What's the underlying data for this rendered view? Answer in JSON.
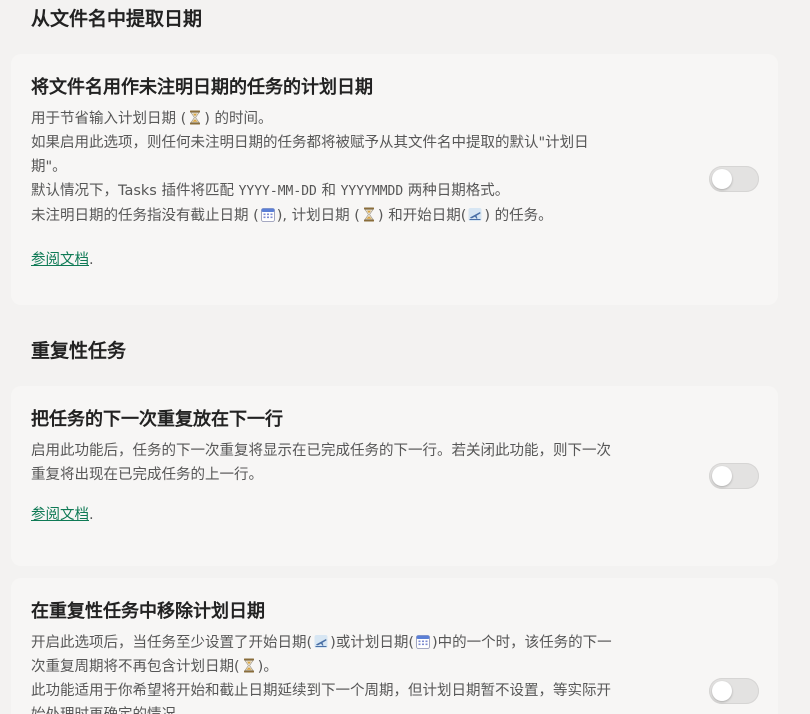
{
  "sections": [
    {
      "heading": "从文件名中提取日期",
      "setting": {
        "title": "将文件名用作未注明日期的任务的计划日期",
        "lines": [
          {
            "a": "用于节省输入计划日期 (",
            "b": ") 的时间。"
          },
          {
            "text": "如果启用此选项，则任何未注明日期的任务都将被赋予从其文件名中提取的默认\"计划日"
          },
          {
            "text": "期\"。"
          },
          {
            "a": "默认情况下，Tasks 插件将匹配 ",
            "code1": "YYYY-MM-DD",
            "b": " 和 ",
            "code2": "YYYYMMDD",
            "c": " 两种日期格式。"
          },
          {
            "a": "未注明日期的任务指没有截止日期 (",
            "b": "), 计划日期 (",
            "c": ") 和开始日期(",
            "d": ") 的任务。"
          }
        ],
        "doc_link": "参阅文档",
        "doc_suffix": ".",
        "toggle_on": false
      }
    },
    {
      "heading": "重复性任务",
      "setting": {
        "title": "把任务的下一次重复放在下一行",
        "lines": [
          {
            "text": "启用此功能后，任务的下一次重复将显示在已完成任务的下一行。若关闭此功能，则下一次"
          },
          {
            "text": "重复将出现在已完成任务的上一行。"
          }
        ],
        "doc_link": "参阅文档",
        "doc_suffix": ".",
        "toggle_on": false
      }
    },
    {
      "setting": {
        "title": "在重复性任务中移除计划日期",
        "lines": [
          {
            "a": "开启此选项后，当任务至少设置了开始日期(",
            "b": ")或计划日期(",
            "c": ")中的一个时，该任务的下一"
          },
          {
            "a": "次重复周期将不再包含计划日期(",
            "b": ")。"
          },
          {
            "text": "此功能适用于你希望将开始和截止日期延续到下一个周期，但计划日期暂不设置，等实际开"
          },
          {
            "text": "始处理时再确定的情况。"
          }
        ],
        "toggle_on": false
      }
    }
  ],
  "icons": {
    "scheduled": "hourglass-icon",
    "due": "calendar-icon",
    "start": "airplane-departure-icon"
  },
  "colors": {
    "link": "#0f7a55",
    "background": "#f3f2f1",
    "card": "#f7f6f5"
  }
}
